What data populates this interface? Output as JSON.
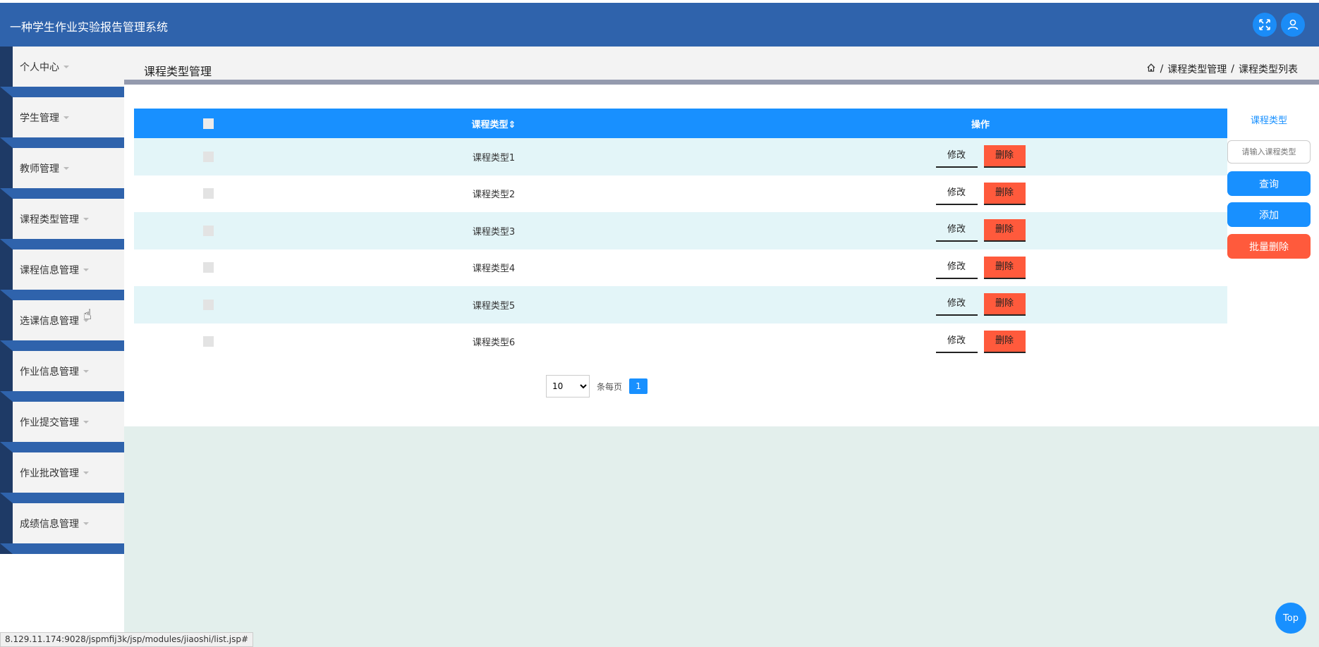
{
  "app": {
    "title": "一种学生作业实验报告管理系统"
  },
  "header_icons": [
    "fullscreen-icon",
    "user-icon"
  ],
  "sidebar": {
    "items": [
      {
        "label": "个人中心"
      },
      {
        "label": "学生管理"
      },
      {
        "label": "教师管理"
      },
      {
        "label": "课程类型管理"
      },
      {
        "label": "课程信息管理"
      },
      {
        "label": "选课信息管理"
      },
      {
        "label": "作业信息管理"
      },
      {
        "label": "作业提交管理"
      },
      {
        "label": "作业批改管理"
      },
      {
        "label": "成绩信息管理"
      }
    ]
  },
  "page": {
    "title": "课程类型管理"
  },
  "breadcrumb": {
    "items": [
      "课程类型管理",
      "课程类型列表"
    ],
    "separator": "/"
  },
  "table": {
    "headers": {
      "name": "课程类型",
      "sort_icon": "⇕",
      "action": "操作"
    },
    "edit_label": "修改",
    "delete_label": "删除",
    "rows": [
      {
        "name": "课程类型1"
      },
      {
        "name": "课程类型2"
      },
      {
        "name": "课程类型3"
      },
      {
        "name": "课程类型4"
      },
      {
        "name": "课程类型5"
      },
      {
        "name": "课程类型6"
      }
    ]
  },
  "pagination": {
    "page_size": "10",
    "per_page_label": "条每页",
    "current_page": "1"
  },
  "search": {
    "label": "课程类型",
    "placeholder": "请输入课程类型",
    "query_label": "查询",
    "add_label": "添加",
    "batch_delete_label": "批量删除"
  },
  "status_url": "8.129.11.174:9028/jspmfij3k/jsp/modules/jiaoshi/list.jsp#",
  "top_button": "Top",
  "colors": {
    "topbar": "#2f63ac",
    "primary": "#1890ff",
    "danger": "#ff5a3c",
    "row_alt": "#e3f5f8"
  }
}
